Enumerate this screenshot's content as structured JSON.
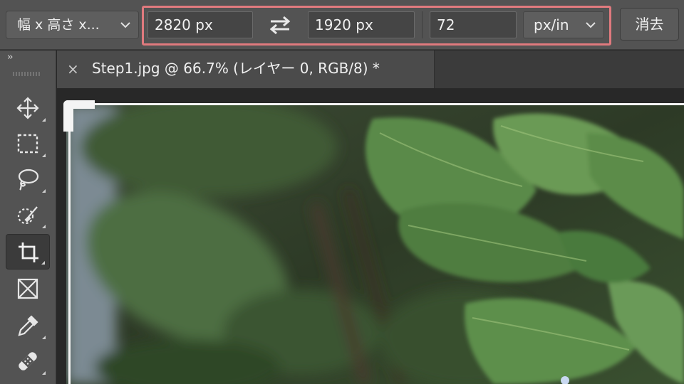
{
  "options_bar": {
    "ratio_preset": "幅 x 高さ x...",
    "width_value": "2820 px",
    "height_value": "1920 px",
    "resolution_value": "72",
    "resolution_unit": "px/in",
    "clear_label": "消去",
    "highlight_color": "#e07a7e"
  },
  "toolbar": {
    "collapse_glyph": "››",
    "tools": [
      {
        "name": "move-tool",
        "icon": "move-icon"
      },
      {
        "name": "rectangular-marquee-tool",
        "icon": "marquee-icon"
      },
      {
        "name": "lasso-tool",
        "icon": "lasso-icon"
      },
      {
        "name": "quick-selection-tool",
        "icon": "quick-selection-icon"
      },
      {
        "name": "crop-tool",
        "icon": "crop-icon",
        "active": true
      },
      {
        "name": "frame-tool",
        "icon": "frame-icon"
      },
      {
        "name": "eyedropper-tool",
        "icon": "eyedropper-icon"
      },
      {
        "name": "healing-brush-tool",
        "icon": "bandage-icon"
      }
    ]
  },
  "document": {
    "tab_close": "×",
    "tab_title": "Step1.jpg @ 66.7% (レイヤー 0, RGB/8) *"
  }
}
